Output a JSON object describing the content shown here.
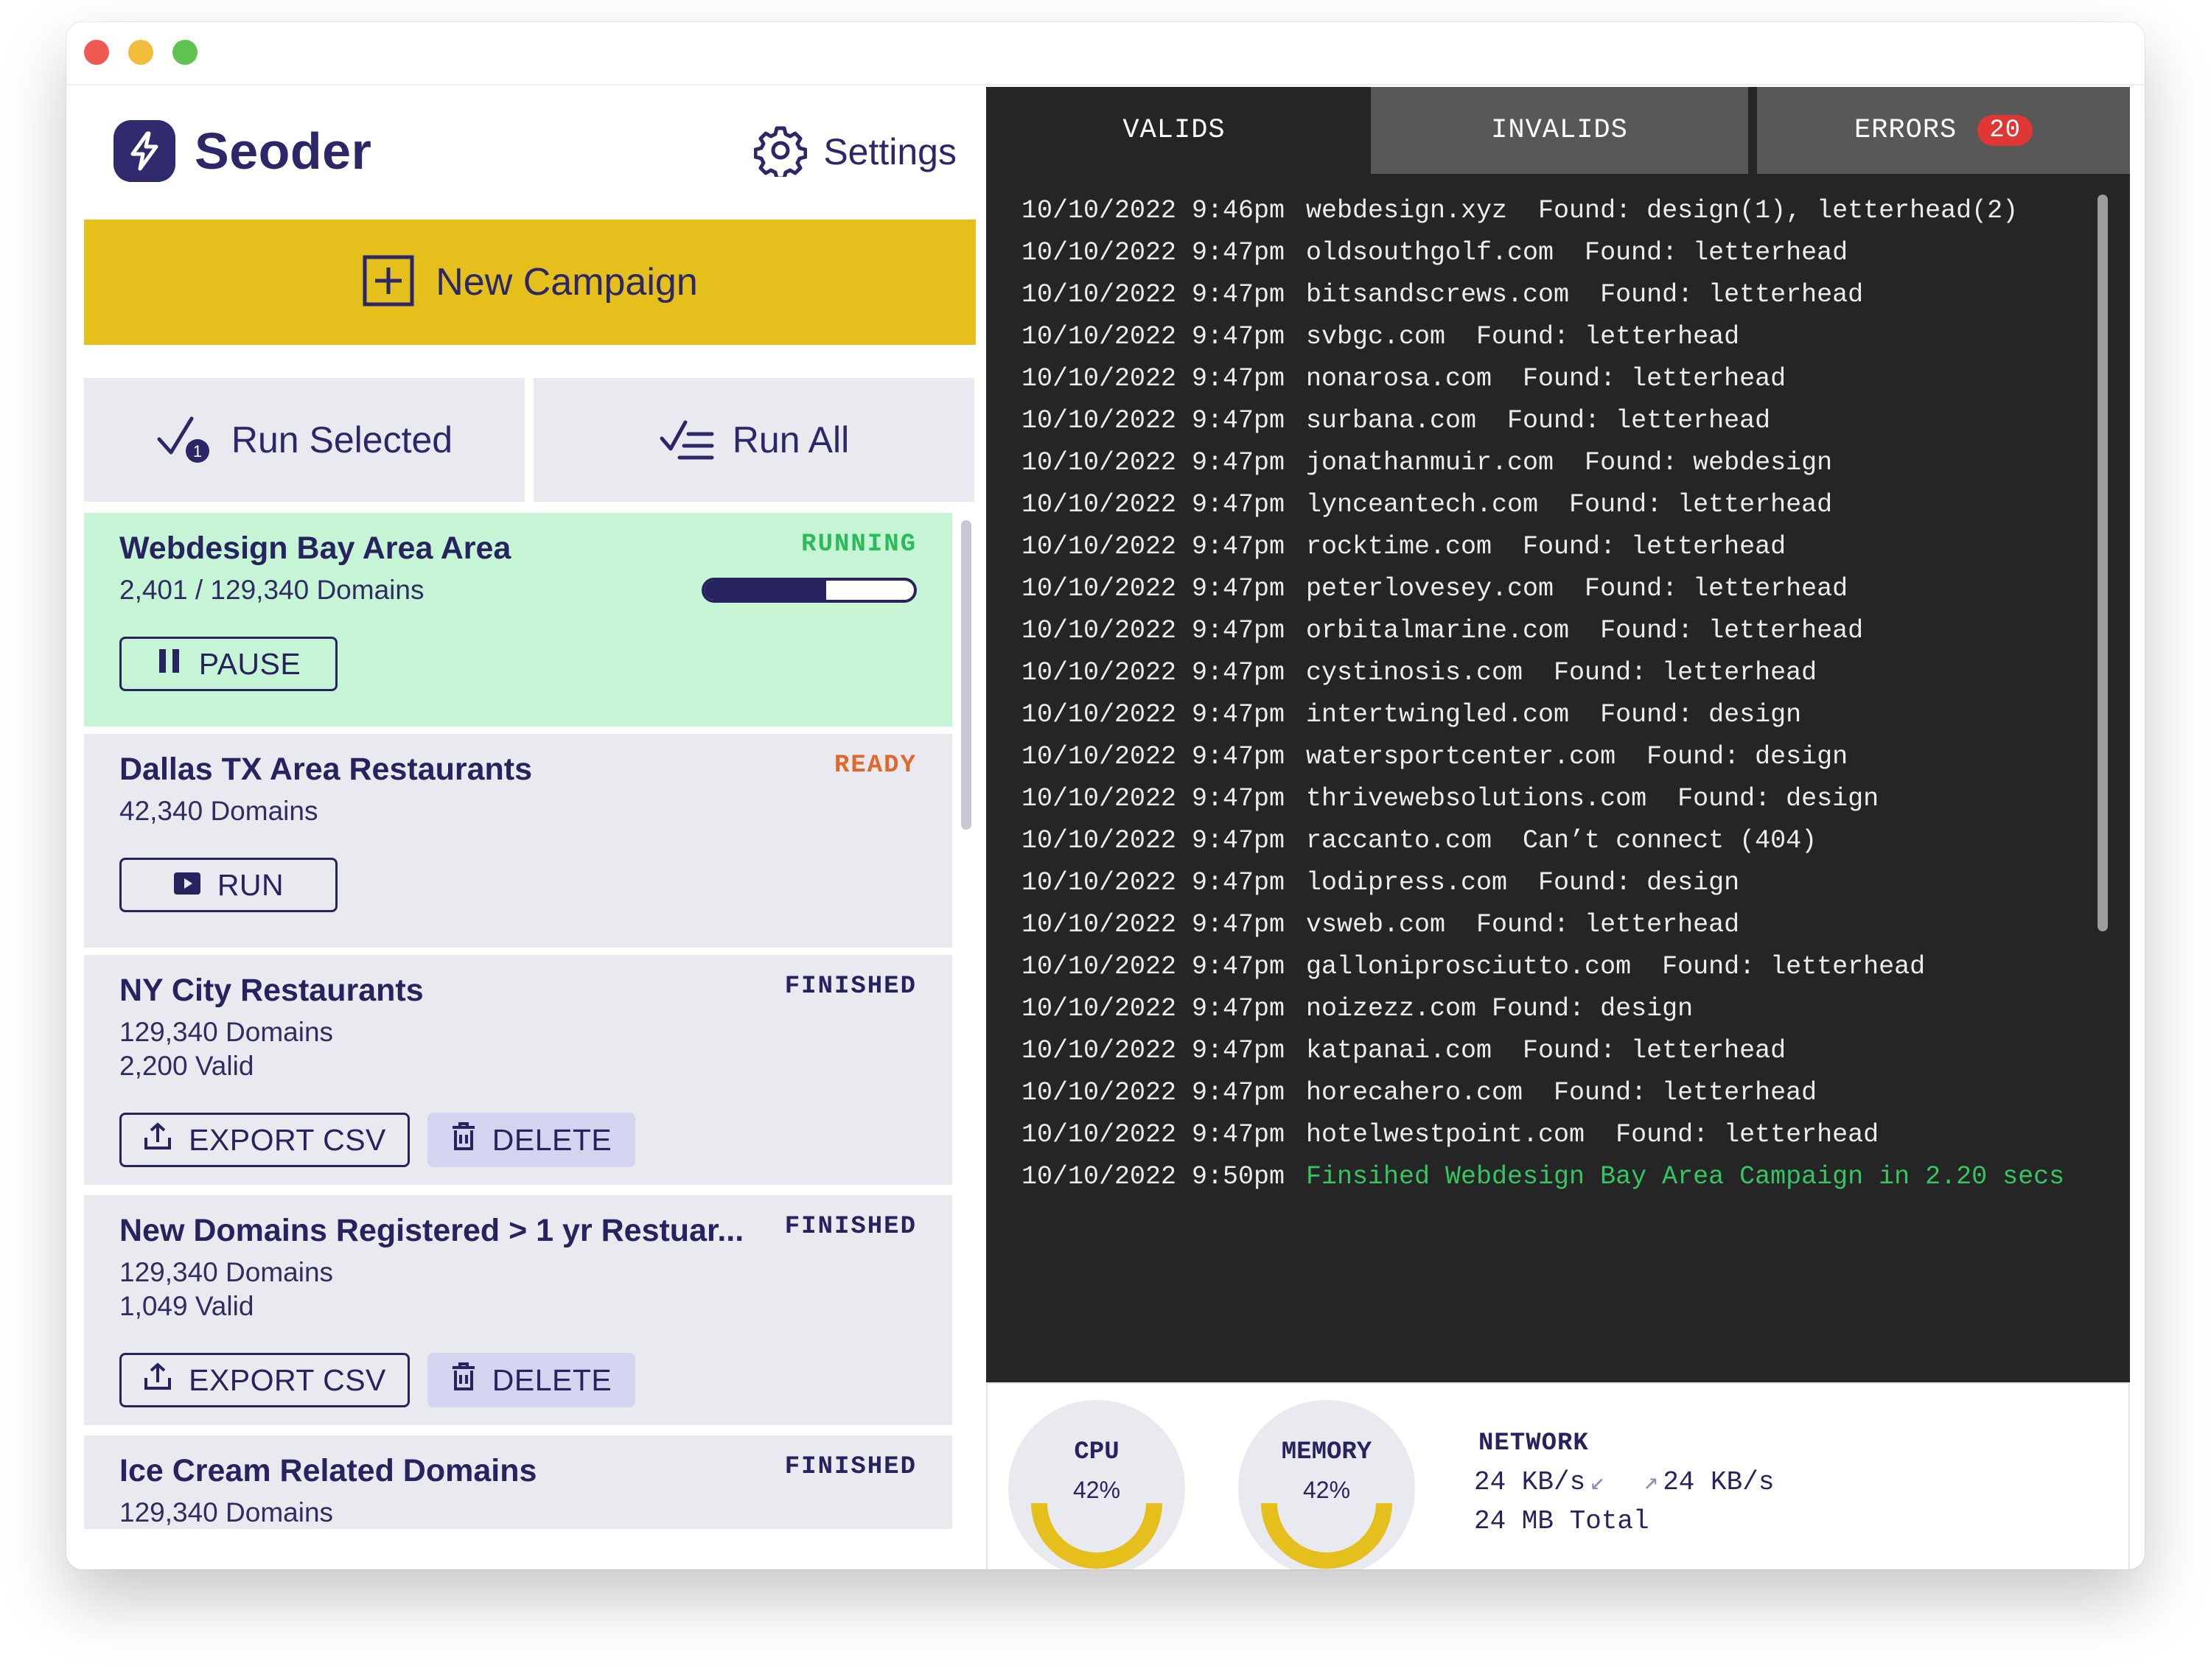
{
  "app": {
    "name": "Seoder",
    "settings_label": "Settings",
    "new_campaign_label": "New Campaign",
    "run_selected_label": "Run Selected",
    "run_selected_badge": "1",
    "run_all_label": "Run All"
  },
  "campaigns": [
    {
      "title": "Webdesign Bay Area Area",
      "status": "RUNNING",
      "line1": "2,401 / 129,340 Domains",
      "progress": 0.58,
      "actions": [
        {
          "label": "PAUSE",
          "icon": "pause-icon"
        }
      ]
    },
    {
      "title": "Dallas TX Area Restaurants",
      "status": "READY",
      "line1": "42,340 Domains",
      "actions": [
        {
          "label": "RUN",
          "icon": "play-icon"
        }
      ]
    },
    {
      "title": "NY City Restaurants",
      "status": "FINISHED",
      "line1": "129,340 Domains",
      "line2": "2,200 Valid",
      "actions": [
        {
          "label": "EXPORT CSV",
          "icon": "export-icon"
        },
        {
          "label": "DELETE",
          "icon": "trash-icon"
        }
      ]
    },
    {
      "title": "New Domains Registered > 1 yr Restuar...",
      "status": "FINISHED",
      "line1": "129,340 Domains",
      "line2": "1,049 Valid",
      "actions": [
        {
          "label": "EXPORT CSV",
          "icon": "export-icon"
        },
        {
          "label": "DELETE",
          "icon": "trash-icon"
        }
      ]
    },
    {
      "title": "Ice Cream Related Domains",
      "status": "FINISHED",
      "line1": "129,340 Domains"
    }
  ],
  "tabs": [
    {
      "label": "VALIDS",
      "active": true
    },
    {
      "label": "INVALIDS",
      "active": false
    },
    {
      "label": "ERRORS",
      "active": false,
      "badge": "20"
    }
  ],
  "log": [
    {
      "time": "10/10/2022 9:46pm",
      "message": "webdesign.xyz  Found: design(1), letterhead(2)"
    },
    {
      "time": "10/10/2022 9:47pm",
      "message": "oldsouthgolf.com  Found: letterhead"
    },
    {
      "time": "10/10/2022 9:47pm",
      "message": "bitsandscrews.com  Found: letterhead"
    },
    {
      "time": "10/10/2022 9:47pm",
      "message": "svbgc.com  Found: letterhead"
    },
    {
      "time": "10/10/2022 9:47pm",
      "message": "nonarosa.com  Found: letterhead"
    },
    {
      "time": "10/10/2022 9:47pm",
      "message": "surbana.com  Found: letterhead"
    },
    {
      "time": "10/10/2022 9:47pm",
      "message": "jonathanmuir.com  Found: webdesign"
    },
    {
      "time": "10/10/2022 9:47pm",
      "message": "lynceantech.com  Found: letterhead"
    },
    {
      "time": "10/10/2022 9:47pm",
      "message": "rocktime.com  Found: letterhead"
    },
    {
      "time": "10/10/2022 9:47pm",
      "message": "peterlovesey.com  Found: letterhead"
    },
    {
      "time": "10/10/2022 9:47pm",
      "message": "orbitalmarine.com  Found: letterhead"
    },
    {
      "time": "10/10/2022 9:47pm",
      "message": "cystinosis.com  Found: letterhead"
    },
    {
      "time": "10/10/2022 9:47pm",
      "message": "intertwingled.com  Found: design"
    },
    {
      "time": "10/10/2022 9:47pm",
      "message": "watersportcenter.com  Found: design"
    },
    {
      "time": "10/10/2022 9:47pm",
      "message": "thrivewebsolutions.com  Found: design"
    },
    {
      "time": "10/10/2022 9:47pm",
      "message": "raccanto.com  Can’t connect (404)"
    },
    {
      "time": "10/10/2022 9:47pm",
      "message": "lodipress.com  Found: design"
    },
    {
      "time": "10/10/2022 9:47pm",
      "message": "vsweb.com  Found: letterhead"
    },
    {
      "time": "10/10/2022 9:47pm",
      "message": "galloniprosciutto.com  Found: letterhead"
    },
    {
      "time": "10/10/2022 9:47pm",
      "message": "noizezz.com Found: design"
    },
    {
      "time": "10/10/2022 9:47pm",
      "message": "katpanai.com  Found: letterhead"
    },
    {
      "time": "10/10/2022 9:47pm",
      "message": "horecahero.com  Found: letterhead"
    },
    {
      "time": "10/10/2022 9:47pm",
      "message": "hotelwestpoint.com  Found: letterhead"
    },
    {
      "time": "10/10/2022 9:50pm",
      "message": "Finsihed Webdesign Bay Area Campaign in 2.20 secs",
      "type": "success"
    }
  ],
  "stats": {
    "cpu": {
      "label": "CPU",
      "value": "42%",
      "fraction": 0.42
    },
    "memory": {
      "label": "MEMORY",
      "value": "42%",
      "fraction": 0.42
    },
    "network": {
      "title": "NETWORK",
      "download": "24 KB/s",
      "upload": "24 KB/s",
      "total": "24 MB Total"
    }
  },
  "colors": {
    "brand": "#2f2b6e",
    "accent": "#e5bf1b",
    "running_bg": "#c6f5d6",
    "running": "#2bbb5b",
    "ready": "#e0682a",
    "error_badge": "#e13636",
    "success_log": "#35c561"
  }
}
